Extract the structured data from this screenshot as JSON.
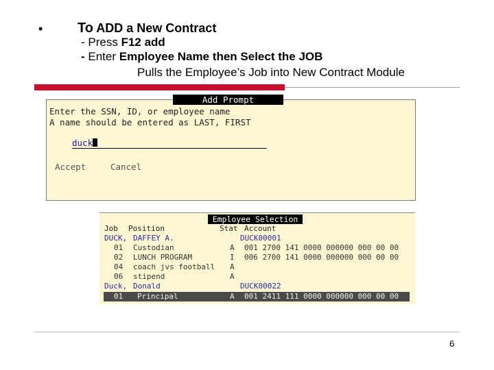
{
  "slide": {
    "bullet": "•",
    "title_prefix": "To",
    "title_rest": " ADD a New Contract",
    "step1_plain": "- Press ",
    "step1_bold": "F12 add",
    "step2_dash": "- ",
    "step2_plain": "Enter ",
    "step2_bold": "Employee Name  then Select the JOB",
    "note": "Pulls the Employee’s Job into New Contract Module",
    "page_number": "6",
    "accent_color": "#c8102e"
  },
  "add_prompt": {
    "title": "Add Prompt",
    "instruction1": "Enter the SSN, ID, or employee name",
    "instruction2": "A name should be entered as LAST, FIRST",
    "input_value": "duck",
    "accept_label": "Accept",
    "cancel_label": "Cancel"
  },
  "employee_selection": {
    "title": "Employee Selection",
    "columns": {
      "job": "Job",
      "position": "Position",
      "stat": "Stat",
      "account": "Account"
    },
    "rows": [
      {
        "job": "DUCK,",
        "position": "DAFFEY A.",
        "stat": "",
        "account": "DUCK00001"
      },
      {
        "job": "01",
        "position": "Custodian",
        "stat": "A",
        "account": "001 2700 141 0000 000000 000 00 00"
      },
      {
        "job": "02",
        "position": "LUNCH PROGRAM",
        "stat": "I",
        "account": "006 2700 141 0000 000000 000 00 00"
      },
      {
        "job": "04",
        "position": "coach jvs football",
        "stat": "A",
        "account": ""
      },
      {
        "job": "06",
        "position": "stipend",
        "stat": "A",
        "account": ""
      },
      {
        "job": "Duck,",
        "position": "Donald",
        "stat": "",
        "account": "DUCK00022"
      },
      {
        "job": "01",
        "position": "Principal",
        "stat": "A",
        "account": "001 2411 111 0000 000000 000 00 00"
      }
    ]
  }
}
